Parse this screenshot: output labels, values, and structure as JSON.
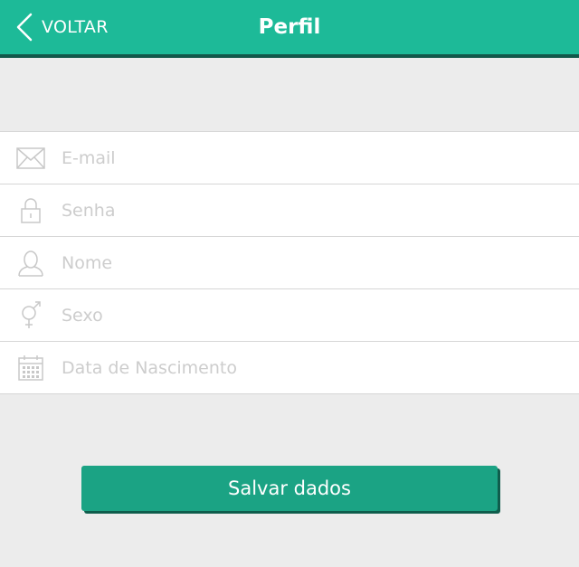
{
  "header": {
    "back_label": "VOLTAR",
    "title": "Perfil",
    "back_icon": "chevron-left-icon"
  },
  "form": {
    "fields": [
      {
        "icon": "envelope-icon",
        "placeholder": "E-mail",
        "value": ""
      },
      {
        "icon": "lock-icon",
        "placeholder": "Senha",
        "value": ""
      },
      {
        "icon": "user-icon",
        "placeholder": "Nome",
        "value": ""
      },
      {
        "icon": "gender-icon",
        "placeholder": "Sexo",
        "value": ""
      },
      {
        "icon": "calendar-icon",
        "placeholder": "Data de Nascimento",
        "value": ""
      }
    ]
  },
  "actions": {
    "save_label": "Salvar dados"
  },
  "colors": {
    "accent": "#1dba98",
    "accent_dark": "#12584a",
    "button": "#1ba384",
    "background": "#ececec",
    "placeholder": "#cdcdcd"
  }
}
